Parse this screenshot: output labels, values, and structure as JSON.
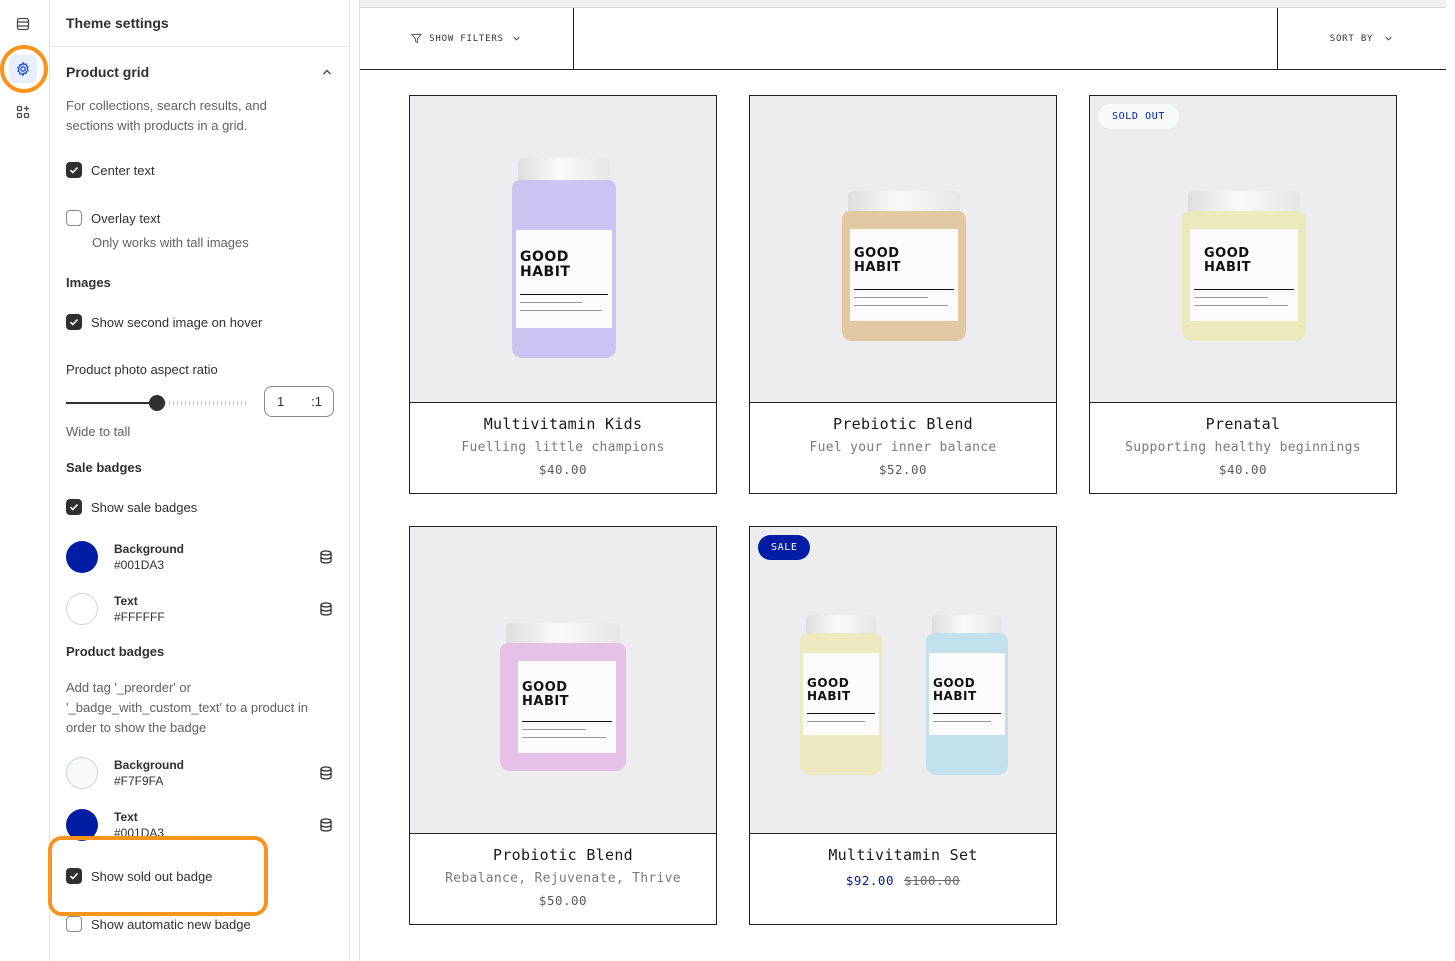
{
  "rail": {
    "icons": [
      "sections-icon",
      "settings-gear-icon",
      "apps-icon"
    ]
  },
  "panel": {
    "title": "Theme settings",
    "section_title": "Product grid",
    "section_desc": "For collections, search results, and sections with products in a grid.",
    "center_text": {
      "label": "Center text",
      "checked": true
    },
    "overlay_text": {
      "label": "Overlay text",
      "checked": false,
      "hint": "Only works with tall images"
    },
    "images_heading": "Images",
    "second_image": {
      "label": "Show second image on hover",
      "checked": true
    },
    "aspect": {
      "label": "Product photo aspect ratio",
      "value": "1",
      "suffix": ":1",
      "hint": "Wide to tall",
      "fraction": 0.5
    },
    "sale_badges_heading": "Sale badges",
    "show_sale_badges": {
      "label": "Show sale badges",
      "checked": true
    },
    "sale_bg": {
      "name": "Background",
      "hex": "#001DA3"
    },
    "sale_text": {
      "name": "Text",
      "hex": "#FFFFFF"
    },
    "product_badges_heading": "Product badges",
    "product_badges_desc": "Add tag '_preorder' or '_badge_with_custom_text' to a product in order to show the badge",
    "prod_bg": {
      "name": "Background",
      "hex": "#F7F9FA"
    },
    "prod_text": {
      "name": "Text",
      "hex": "#001DA3"
    },
    "sold_out_badge": {
      "label": "Show sold out badge",
      "checked": true
    },
    "auto_new_badge": {
      "label": "Show automatic new badge",
      "checked": false
    }
  },
  "storefront": {
    "filters_label": "SHOW FILTERS",
    "sort_label": "SORT BY",
    "products": [
      {
        "title": "Multivitamin Kids",
        "subtitle": "Fuelling little champions",
        "price": "$40.00",
        "badge": "",
        "jar_color": "#c9c2f2"
      },
      {
        "title": "Prebiotic Blend",
        "subtitle": "Fuel your inner balance",
        "price": "$52.00",
        "badge": "",
        "jar_color": "#e2c79e"
      },
      {
        "title": "Prenatal",
        "subtitle": "Supporting healthy beginnings",
        "price": "$40.00",
        "badge": "SOLD OUT",
        "jar_color": "#ebeab8"
      },
      {
        "title": "Probiotic Blend",
        "subtitle": "Rebalance, Rejuvenate, Thrive",
        "price": "$50.00",
        "badge": "",
        "jar_color": "#e6bfe6"
      },
      {
        "title": "Multivitamin Set",
        "subtitle": "",
        "sale_price": "$92.00",
        "compare_price": "$100.00",
        "badge": "SALE",
        "jar_colors": [
          "#ede9bd",
          "#bfe0ec"
        ]
      }
    ],
    "jar_brand": "GOOD\nHABIT"
  }
}
